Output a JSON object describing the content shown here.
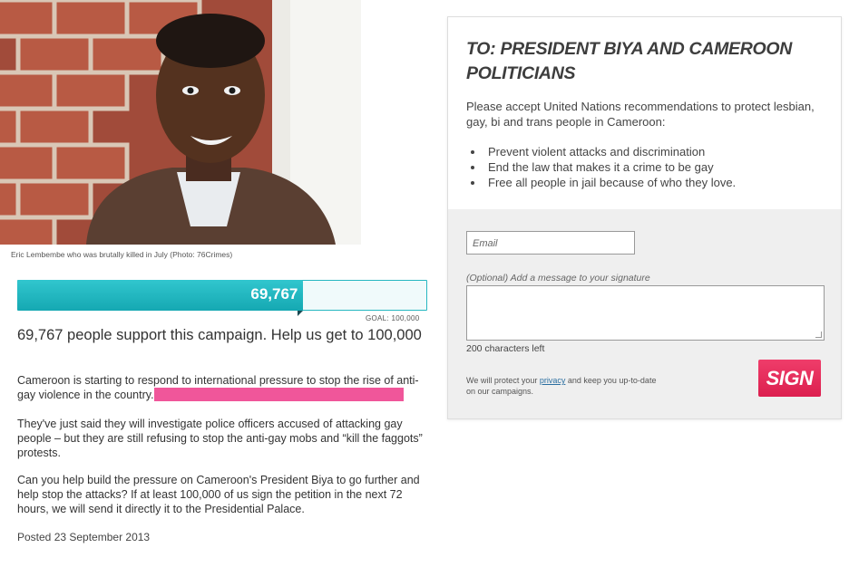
{
  "photo": {
    "caption": "Eric Lembembe who was brutally killed in July (Photo: 76Crimes)"
  },
  "progress": {
    "value_label": "69,767",
    "fraction": 0.6977,
    "goal_label": "GOAL: 100,000"
  },
  "support_text": "69,767 people support this campaign. Help us get to 100,000",
  "article": {
    "p1": "Cameroon is starting to respond to international pressure to stop the rise of anti-gay violence in the country.",
    "p2": "They've just said they will investigate police officers accused of attacking gay people – but they are still refusing to stop the anti-gay mobs and “kill the faggots” protests.",
    "p3": "Can you help build the pressure on Cameroon's President Biya to go further and help stop the attacks? If at least 100,000 of us sign the petition in the next 72 hours, we will send it directly it to the Presidential Palace.",
    "posted": "Posted 23 September 2013"
  },
  "petition": {
    "title": "TO: PRESIDENT BIYA AND CAMEROON POLITICIANS",
    "intro": "Please accept United Nations recommendations to protect lesbian, gay, bi and trans people in Cameroon:",
    "demands": [
      "Prevent violent attacks and discrimination",
      "End the law that makes it a crime to be gay",
      "Free all people in jail because of who they love."
    ]
  },
  "form": {
    "email_placeholder": "Email",
    "message_label": "(Optional) Add a message to your signature",
    "chars_left": "200 characters left",
    "privacy_before": "We will protect your ",
    "privacy_link": "privacy",
    "privacy_after": " and keep you up-to-date on our campaigns.",
    "sign_label": "SIGN"
  },
  "colors": {
    "accent": "#1db3bd",
    "sign": "#e42a57",
    "highlight": "#f0569a"
  }
}
